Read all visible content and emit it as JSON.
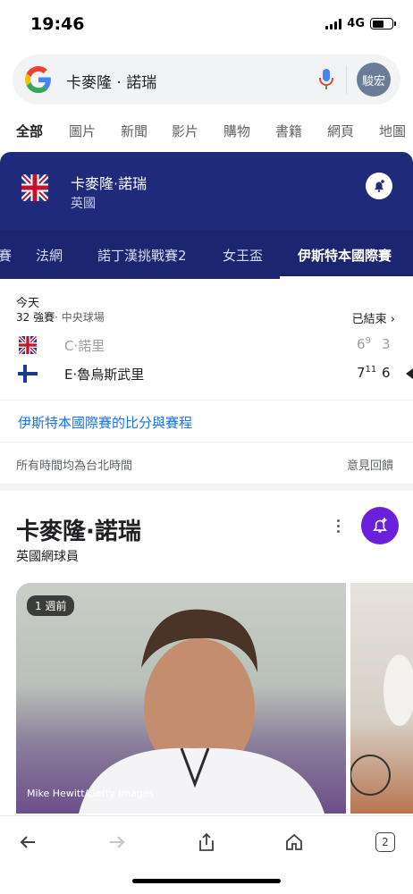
{
  "status_bar": {
    "time": "19:46",
    "network": "4G"
  },
  "search": {
    "query": "卡麥隆 · 諾瑞",
    "avatar_text": "駿宏"
  },
  "tabs": [
    "全部",
    "圖片",
    "新聞",
    "影片",
    "購物",
    "書籍",
    "網頁",
    "地圖"
  ],
  "sports_card": {
    "player_name": "卡麥隆·諾瑞",
    "country": "英國",
    "tabs": [
      "賽",
      "法網",
      "諾丁漢挑戰賽2",
      "女王盃",
      "伊斯特本國際賽"
    ],
    "active_tab": "伊斯特本國際賽"
  },
  "match": {
    "day": "今天",
    "round": "32 強賽",
    "venue": "· 中央球場",
    "status": "已結束",
    "players": [
      {
        "name": "C·諾里",
        "set1": "6",
        "set1_tb": "9",
        "set2": "3",
        "flag": "uk",
        "winner": false
      },
      {
        "name": "E·魯烏斯武里",
        "set1": "7",
        "set1_tb": "11",
        "set2": "6",
        "flag": "finland",
        "winner": true
      }
    ]
  },
  "links": {
    "scores_link": "伊斯特本國際賽的比分與賽程",
    "timezone_note": "所有時間均為台北時間",
    "feedback": "意見回饋"
  },
  "knowledge_panel": {
    "title": "卡麥隆·諾瑞",
    "subtitle": "英國網球員",
    "photo_badge": "1 週前",
    "photo_credit": "Mike Hewitt/Getty Images"
  },
  "bottom_nav": {
    "tab_count": "2"
  },
  "colors": {
    "card_bg": "#1f2a7a",
    "bell_purple": "#6b21d9",
    "link_blue": "#1a73e8"
  }
}
